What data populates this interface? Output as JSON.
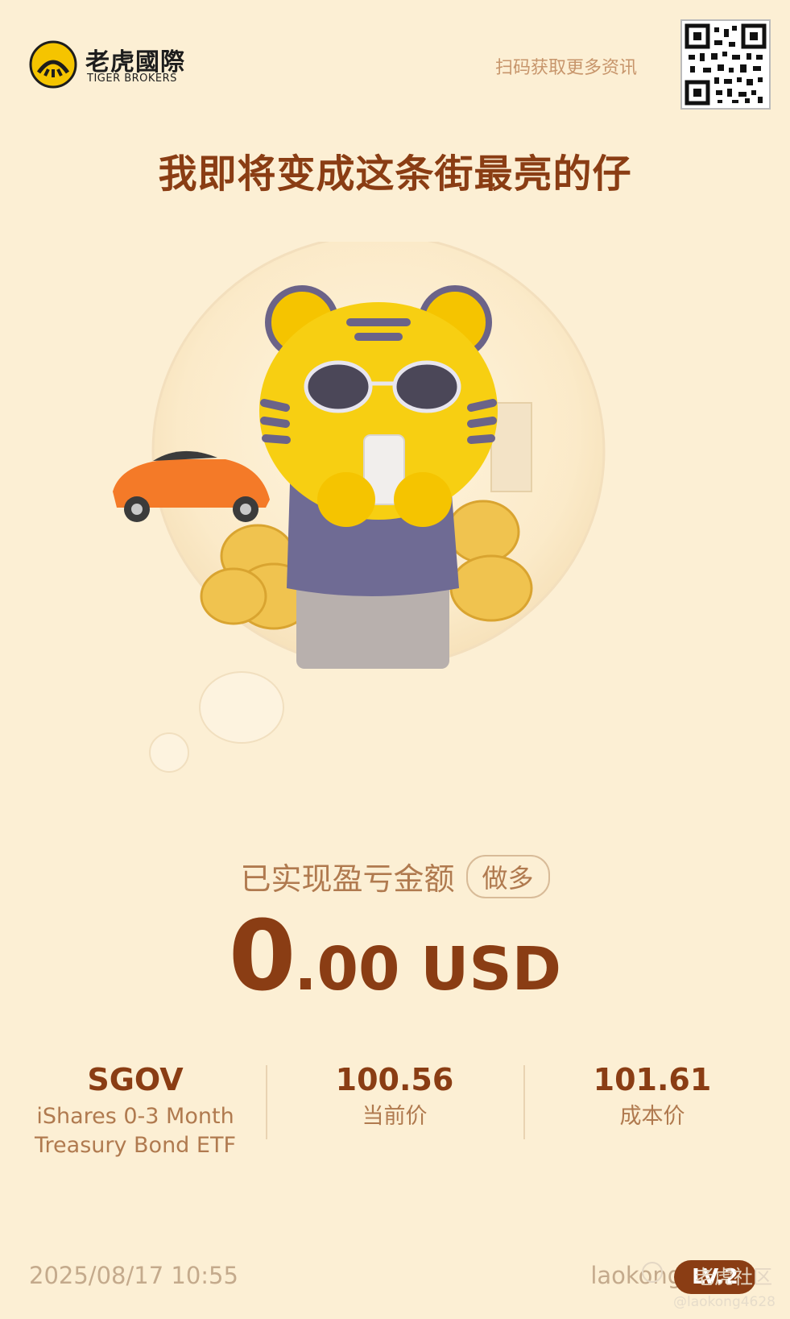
{
  "header": {
    "brand_cn": "老虎國際",
    "brand_en": "TIGER BROKERS",
    "scan_text": "扫码获取更多资讯"
  },
  "headline": "我即将变成这条街最亮的仔",
  "pnl": {
    "label": "已实现盈亏金额",
    "tag": "做多",
    "int_part": "0",
    "rest_part": ".00 USD"
  },
  "stats": {
    "ticker": "SGOV",
    "name_line1": "iShares 0-3 Month",
    "name_line2": "Treasury Bond ETF",
    "current_price": "100.56",
    "current_price_label": "当前价",
    "cost_price": "101.61",
    "cost_price_label": "成本价"
  },
  "footer": {
    "date": "2025/08/17 10:55",
    "user": "laokong4628",
    "badge": "LV.2"
  },
  "watermark": {
    "text": "老虎社区",
    "handle": "@laokong4628"
  },
  "colors": {
    "background": "#fcefd4",
    "accent": "#8a3d14",
    "muted": "#b07a4f"
  }
}
